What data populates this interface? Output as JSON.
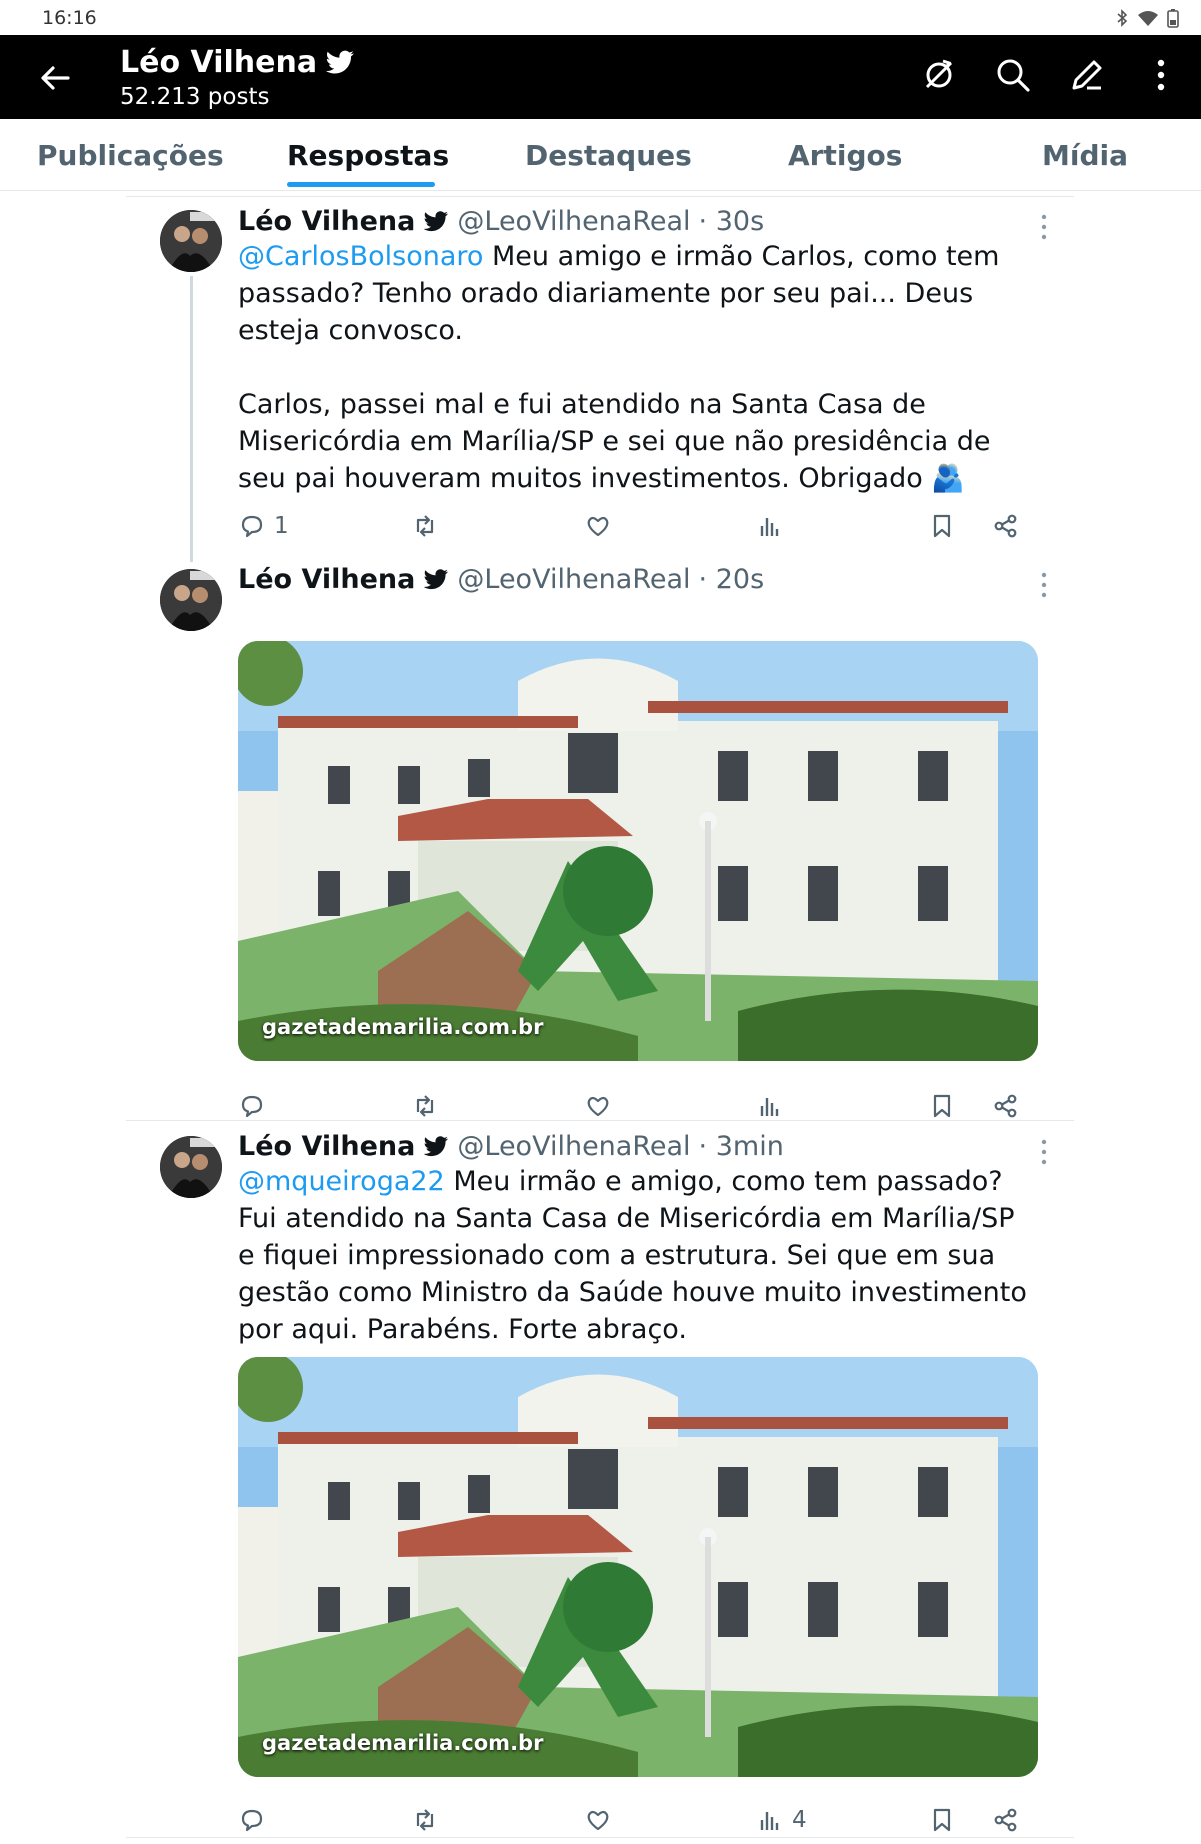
{
  "status_bar": {
    "time": "16:16"
  },
  "header": {
    "back_icon": "arrow-left-icon",
    "name": "Léo Vilhena",
    "posts": "52.213 posts",
    "actions": [
      "no-sync-icon",
      "search-icon",
      "compose-icon",
      "more-vertical-icon"
    ]
  },
  "tabs": [
    {
      "label": "Publicações",
      "active": false
    },
    {
      "label": "Respostas",
      "active": true
    },
    {
      "label": "Destaques",
      "active": false
    },
    {
      "label": "Artigos",
      "active": false
    },
    {
      "label": "Mídia",
      "active": false
    }
  ],
  "tweets": [
    {
      "name": "Léo Vilhena",
      "handle": "@LeoVilhenaReal",
      "time": "· 30s",
      "mention": "@CarlosBolsonaro",
      "text": " Meu amigo e irmão Carlos, como tem passado? Tenho orado diariamente por seu pai... Deus esteja convosco.\n\nCarlos, passei mal e fui atendido na Santa Casa de Misericórdia em Marília/SP e sei que não presidência de seu pai houveram muitos investimentos. Obrigado 🫂",
      "reply_count": "1",
      "views_count": ""
    },
    {
      "name": "Léo Vilhena",
      "handle": "@LeoVilhenaReal",
      "time": "· 20s",
      "image_watermark": "gazetademarilia.com.br",
      "reply_count": "",
      "views_count": ""
    },
    {
      "name": "Léo Vilhena",
      "handle": "@LeoVilhenaReal",
      "time": "· 3min",
      "mention": "@mqueiroga22",
      "text": " Meu irmão e amigo, como tem passado? Fui atendido na Santa Casa de Misericórdia em Marília/SP e fiquei impressionado com a estrutura. Sei que em sua gestão como Ministro da Saúde houve muito investimento por aqui. Parabéns. Forte abraço.",
      "image_watermark": "gazetademarilia.com.br",
      "reply_count": "",
      "views_count": "4"
    }
  ],
  "colors": {
    "accent": "#1d9bf0",
    "text": "#0f1419",
    "muted": "#536471",
    "header_bg": "#000000"
  }
}
